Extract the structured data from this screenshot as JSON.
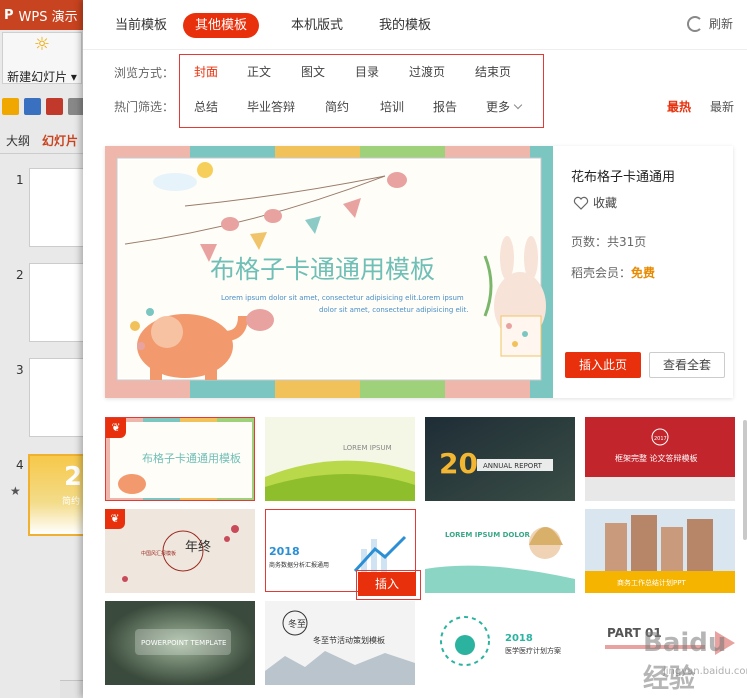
{
  "app": {
    "title": "WPS 演示",
    "new_slide": "新建幻灯片",
    "left_tabs": [
      "大纲",
      "幻灯片"
    ],
    "slide_numbers": [
      "1",
      "2",
      "3",
      "4"
    ],
    "slide4_big": "2",
    "slide4_small": "简约"
  },
  "top_tabs": [
    "当前模板",
    "其他模板",
    "本机版式",
    "我的模板"
  ],
  "active_tab": "其他模板",
  "refresh_label": "刷新",
  "filters": {
    "browse_label": "浏览方式：",
    "browse": [
      "封面",
      "正文",
      "图文",
      "目录",
      "过渡页",
      "结束页"
    ],
    "hot_label": "热门筛选：",
    "hot": [
      "总结",
      "毕业答辩",
      "简约",
      "培训",
      "报告",
      "更多"
    ],
    "sort": [
      "最热",
      "最新"
    ]
  },
  "hero": {
    "title": "花布格子卡通通用",
    "favorite": "收藏",
    "pages": "页数：共31页",
    "member_label": "稻壳会员：",
    "member_value": "免费",
    "insert_button": "插入此页",
    "view_all_button": "查看全套",
    "image_title": "布格子卡通通用模板",
    "image_subtitle1": "Lorem ipsum dolor sit amet, consectetur adipisicing elit.Lorem ipsum",
    "image_subtitle2": "dolor sit amet, consectetur adipisicing elit."
  },
  "grid": {
    "cards": [
      {
        "id": "c1",
        "text": "布格子卡通通用模板",
        "badge": true
      },
      {
        "id": "c2",
        "text": "LOREM IPSUM"
      },
      {
        "id": "c3",
        "text": "20",
        "sub": "ANNUAL REPORT"
      },
      {
        "id": "c4",
        "text": "框架完整 论文答辩模板",
        "year": "2017"
      },
      {
        "id": "c5",
        "text": "年终",
        "sub": "中国风汇报模板",
        "badge": true
      },
      {
        "id": "c6",
        "text": "2018",
        "sub": "商务数据分析汇报通用"
      },
      {
        "id": "c7",
        "text": "LOREM IPSUM DOLOR"
      },
      {
        "id": "c8",
        "text": "商务工作总结计划PPT"
      },
      {
        "id": "c9",
        "text": "POWERPOINT TEMPLATE"
      },
      {
        "id": "c10",
        "text": "冬至节活动策划模板",
        "sub": "冬至"
      },
      {
        "id": "c11",
        "text": "2018",
        "sub": "医学医疗计划方案"
      },
      {
        "id": "c12",
        "text": "PART 01"
      }
    ],
    "hover_insert": "插入"
  },
  "colors": {
    "accent": "#e8310c",
    "highlight": "#e23a35",
    "member_free": "#e88a00"
  },
  "watermark": "Baidu经验",
  "watermark_sub": "jingyan.baidu.com"
}
